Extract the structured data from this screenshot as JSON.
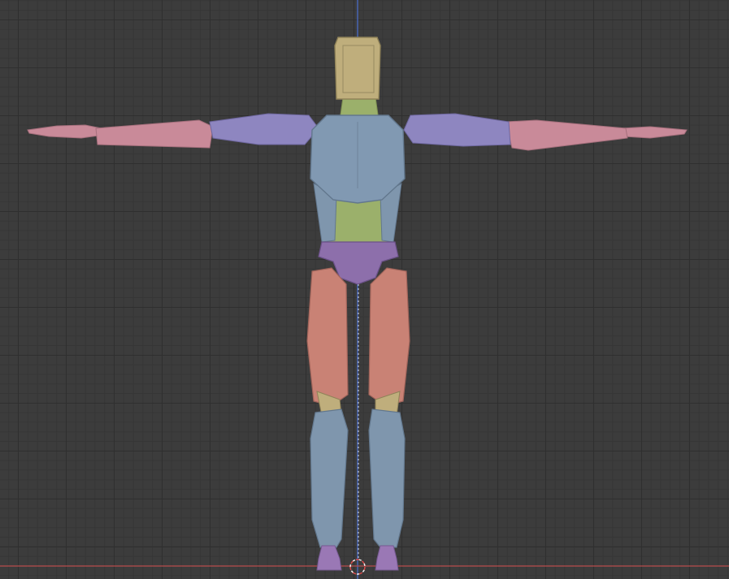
{
  "viewport": {
    "view": "front-orthographic",
    "grid_visible": true,
    "background_color": "#3c3c3c",
    "grid_color": "#2f2f2f",
    "x_axis_color": "#b84b4b",
    "z_axis_color": "#4a6fd0"
  },
  "model": {
    "pose": "T-pose",
    "part_colors": {
      "head": "#bfae7c",
      "torso": "#7f96ad",
      "upper_arm": "#8e86c0",
      "forearm": "#c98a99",
      "pelvis": "#8d6fab",
      "thigh": "#c98275",
      "shin": "#7f96ad",
      "foot": "#9a78b5",
      "muscle": "#9bb06b"
    }
  },
  "cursor_3d": {
    "icon": "3d-cursor-icon",
    "color": "#d84a4a"
  }
}
